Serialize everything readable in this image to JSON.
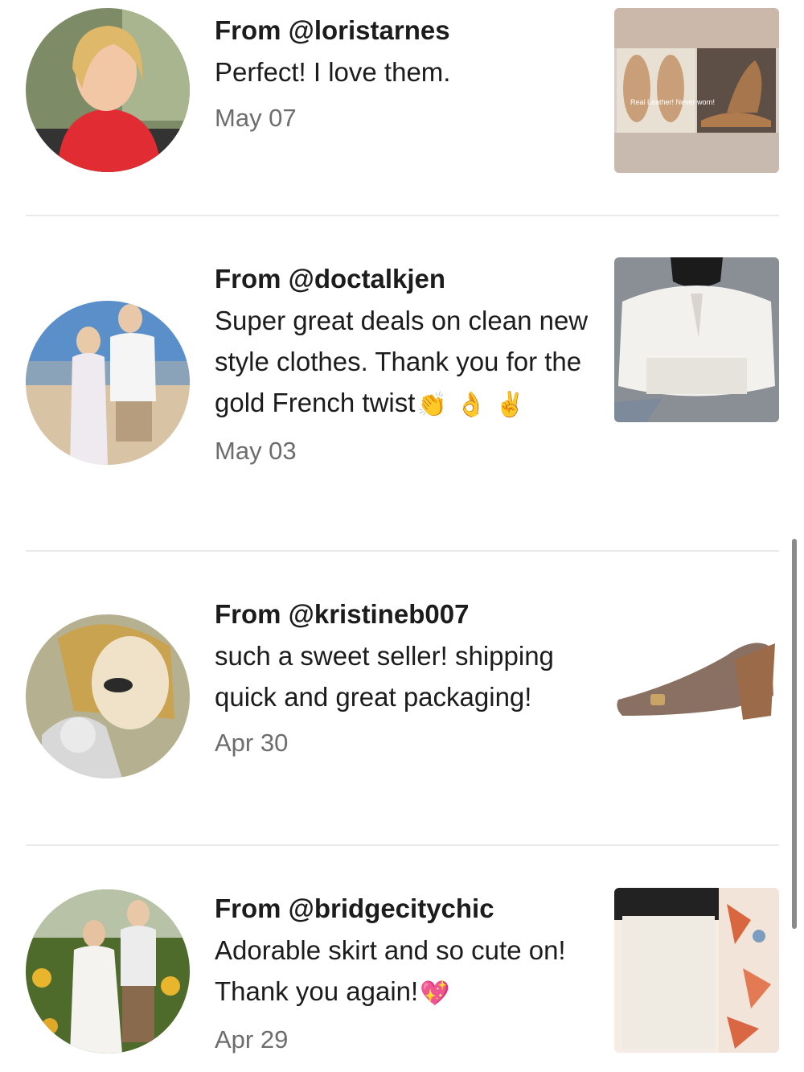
{
  "reviews": [
    {
      "from": "From @loristarnes",
      "text": "Perfect! I love them.",
      "date": "May 07",
      "emojis": []
    },
    {
      "from": "From @doctalkjen",
      "text": "Super great deals on clean new style clothes. Thank you for the gold French twist",
      "date": "May 03",
      "emojis": [
        "👏",
        "👌",
        "✌️"
      ]
    },
    {
      "from": "From @kristineb007",
      "text": "such a sweet seller! shipping quick and great packaging!",
      "date": "Apr 30",
      "emojis": []
    },
    {
      "from": "From @bridgecitychic",
      "text": "Adorable skirt and so cute on! Thank you again!",
      "date": "Apr 29",
      "emojis": [
        "💖"
      ]
    }
  ],
  "thumb_overlay_text": "Real Leather! Never worn!",
  "icons": [
    "avatar-photo",
    "product-photo"
  ]
}
